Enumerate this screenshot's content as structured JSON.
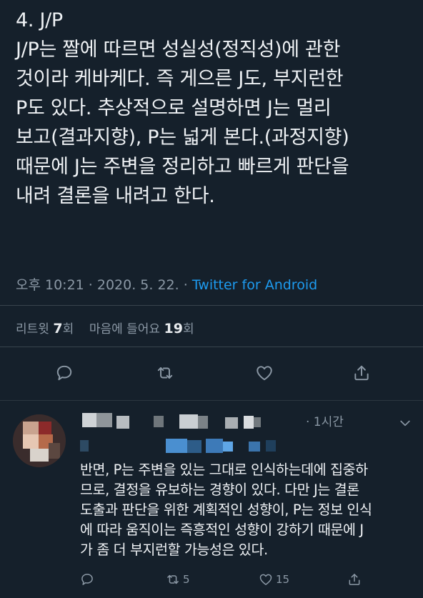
{
  "tweet": {
    "lines": [
      "4. J/P",
      "J/P는 짤에 따르면 성실성(정직성)에 관한",
      "것이라 케바케다. 즉 게으른 J도, 부지런한",
      "P도 있다. 추상적으로 설명하면 J는 멀리",
      "보고(결과지향), P는 넓게 본다.(과정지향)",
      "때문에 J는 주변을 정리하고 빠르게 판단을",
      "내려 결론을 내려고 한다."
    ],
    "timestamp": "오후 10:21 · 2020. 5. 22. · ",
    "source": "Twitter for Android",
    "retweet_label": "리트윗 ",
    "retweet_count": "7",
    "retweet_unit": "회",
    "like_label": "마음에 들어요 ",
    "like_count": "19",
    "like_unit": "회"
  },
  "reply": {
    "time": "· 1시간",
    "lines": [
      "반면, P는 주변을 있는 그대로 인식하는데에 집중하",
      "므로, 결정을 유보하는 경향이 있다. 다만 J는 결론",
      "도출과 판단을 위한 계획적인 성향이, P는 정보 인식",
      "에 따라 움직이는 즉흥적인 성향이 강하기 때문에 J",
      "가 좀 더 부지런할 가능성은 있다."
    ],
    "retweet_count": "5",
    "like_count": "15"
  },
  "icons": {
    "reply": "reply-icon",
    "retweet": "retweet-icon",
    "like": "heart-icon",
    "share": "share-icon",
    "more": "chevron-down-icon"
  },
  "colors": {
    "background": "#15202b",
    "text": "#eef1f4",
    "secondary": "#8b98a5",
    "link": "#1d9bf0",
    "divider": "#38444d"
  }
}
